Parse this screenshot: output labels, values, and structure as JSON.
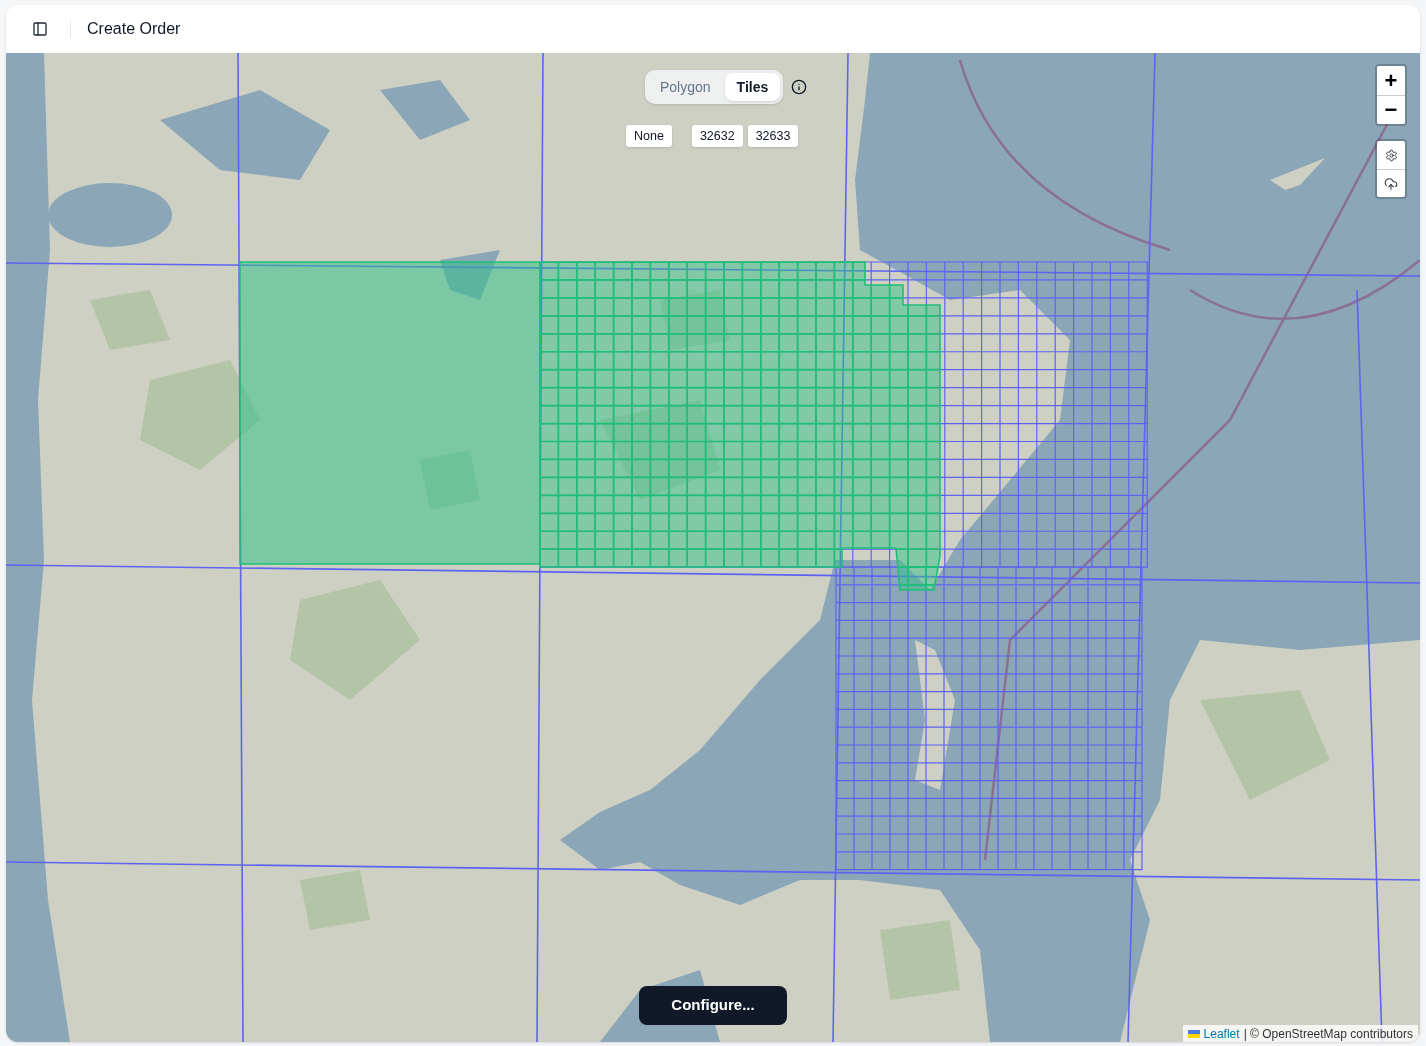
{
  "header": {
    "title": "Create Order"
  },
  "map": {
    "mode_toggle": [
      {
        "label": "Polygon",
        "selected": false
      },
      {
        "label": "Tiles",
        "selected": true
      }
    ],
    "projection_buttons": [
      {
        "label": "None"
      },
      {
        "label": "32632"
      },
      {
        "label": "32633"
      }
    ],
    "zoom_controls": [
      {
        "label": "+"
      },
      {
        "label": "−"
      }
    ],
    "configure_button": {
      "label": "Configure..."
    },
    "attribution": {
      "link": "Leaflet",
      "text": "| © OpenStreetMap contributors"
    }
  }
}
